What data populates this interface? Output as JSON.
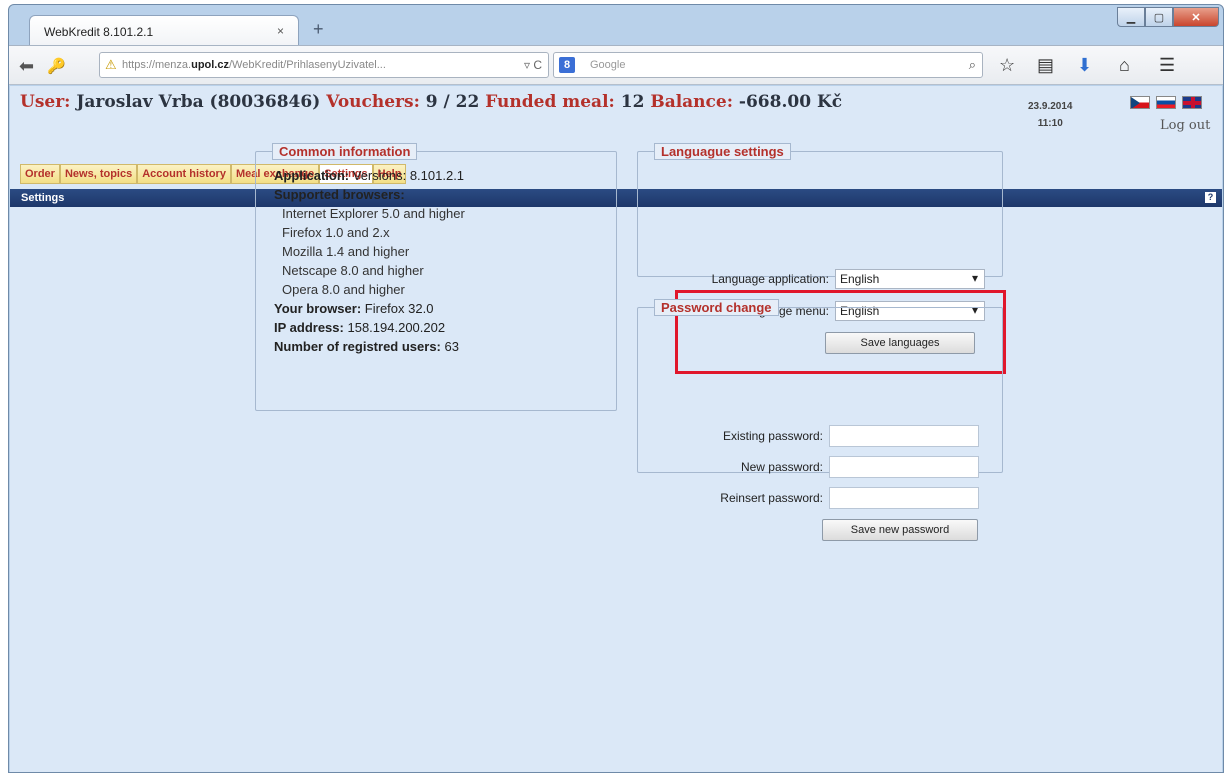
{
  "browser": {
    "tab_title": "WebKredit 8.101.2.1",
    "tab_close": "×",
    "new_tab": "+",
    "url_prefix": "https://menza.",
    "url_domain": "upol.cz",
    "url_path": "/WebKredit/PrihlasenyUzivatel...",
    "search_placeholder": "Google",
    "icons": [
      "back-icon",
      "key-icon",
      "warning-icon",
      "reload-icon",
      "google-icon",
      "search-icon",
      "star-icon",
      "reader-icon",
      "download-icon",
      "home-icon",
      "menu-icon"
    ]
  },
  "header": {
    "user_label": "User:",
    "user_value": "Jaroslav Vrba (80036846)",
    "vouchers_label": "Vouchers:",
    "vouchers_value": "9 / 22",
    "funded_label": "Funded meal:",
    "funded_value": "12",
    "balance_label": "Balance:",
    "balance_value": "-668.00 Kč",
    "date": "23.9.2014",
    "time": "11:10",
    "logout": "Log out"
  },
  "menu": [
    {
      "label": "Order",
      "active": false
    },
    {
      "label": "News, topics",
      "active": false
    },
    {
      "label": "Account history",
      "active": false
    },
    {
      "label": "Meal exchange",
      "active": false
    },
    {
      "label": "Settings",
      "active": true
    },
    {
      "label": "Help",
      "active": false
    }
  ],
  "section": {
    "title": "Settings",
    "help": "?"
  },
  "common": {
    "legend": "Common information",
    "application_label": "Application:",
    "application_value": "Versions: 8.101.2.1",
    "supported_label": "Supported browsers:",
    "browsers": [
      "Internet Explorer 5.0 and higher",
      "Firefox 1.0 and 2.x",
      "Mozilla 1.4 and higher",
      "Netscape 8.0 and higher",
      "Opera 8.0 and higher"
    ],
    "your_browser_label": "Your browser:",
    "your_browser_value": "Firefox 32.0",
    "ip_label": "IP address:",
    "ip_value": "158.194.200.202",
    "users_label": "Number of registred users:",
    "users_value": "63"
  },
  "language": {
    "legend": "Languague settings",
    "app_label": "Language application:",
    "app_value": "English",
    "menu_label": "Language menu:",
    "menu_value": "English",
    "save": "Save languages"
  },
  "password": {
    "legend": "Password change",
    "existing": "Existing password:",
    "new": "New password:",
    "reinsert": "Reinsert password:",
    "save": "Save new password"
  }
}
